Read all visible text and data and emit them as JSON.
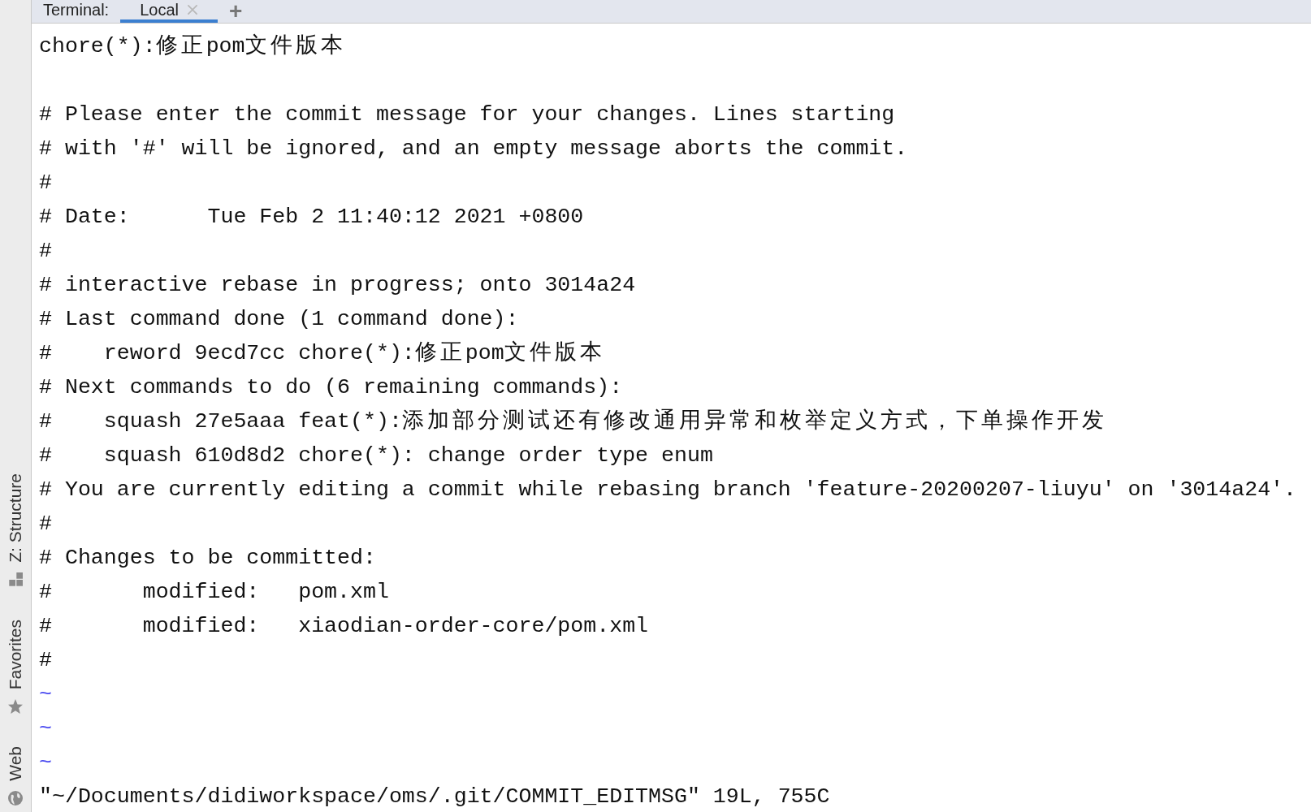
{
  "tool_stripe": {
    "items": [
      {
        "label": "Z: Structure",
        "kind": "structure"
      },
      {
        "label": "Favorites",
        "kind": "star"
      },
      {
        "label": "Web",
        "kind": "globe"
      }
    ]
  },
  "terminal": {
    "label": "Terminal:",
    "tabs": [
      {
        "label": "Local",
        "selected": true
      }
    ],
    "add_button": "+",
    "lines": [
      {
        "kind": "text",
        "text": "chore(*):修正pom文件版本"
      },
      {
        "kind": "blank"
      },
      {
        "kind": "text",
        "text": "# Please enter the commit message for your changes. Lines starting"
      },
      {
        "kind": "text",
        "text": "# with '#' will be ignored, and an empty message aborts the commit."
      },
      {
        "kind": "text",
        "text": "#"
      },
      {
        "kind": "text",
        "text": "# Date:      Tue Feb 2 11:40:12 2021 +0800"
      },
      {
        "kind": "text",
        "text": "#"
      },
      {
        "kind": "text",
        "text": "# interactive rebase in progress; onto 3014a24"
      },
      {
        "kind": "text",
        "text": "# Last command done (1 command done):"
      },
      {
        "kind": "text",
        "text": "#    reword 9ecd7cc chore(*):修正pom文件版本"
      },
      {
        "kind": "text",
        "text": "# Next commands to do (6 remaining commands):"
      },
      {
        "kind": "text",
        "text": "#    squash 27e5aaa feat(*):添加部分测试还有修改通用异常和枚举定义方式，下单操作开发"
      },
      {
        "kind": "text",
        "text": "#    squash 610d8d2 chore(*): change order type enum"
      },
      {
        "kind": "text",
        "text": "# You are currently editing a commit while rebasing branch 'feature-20200207-liuyu' on '3014a24'."
      },
      {
        "kind": "text",
        "text": "#"
      },
      {
        "kind": "text",
        "text": "# Changes to be committed:"
      },
      {
        "kind": "text",
        "text": "#       modified:   pom.xml"
      },
      {
        "kind": "text",
        "text": "#       modified:   xiaodian-order-core/pom.xml"
      },
      {
        "kind": "text",
        "text": "#"
      },
      {
        "kind": "tilde",
        "text": "~"
      },
      {
        "kind": "tilde",
        "text": "~"
      },
      {
        "kind": "tilde",
        "text": "~"
      },
      {
        "kind": "status",
        "text": "\"~/Documents/didiworkspace/oms/.git/COMMIT_EDITMSG\" 19L, 755C"
      }
    ]
  }
}
